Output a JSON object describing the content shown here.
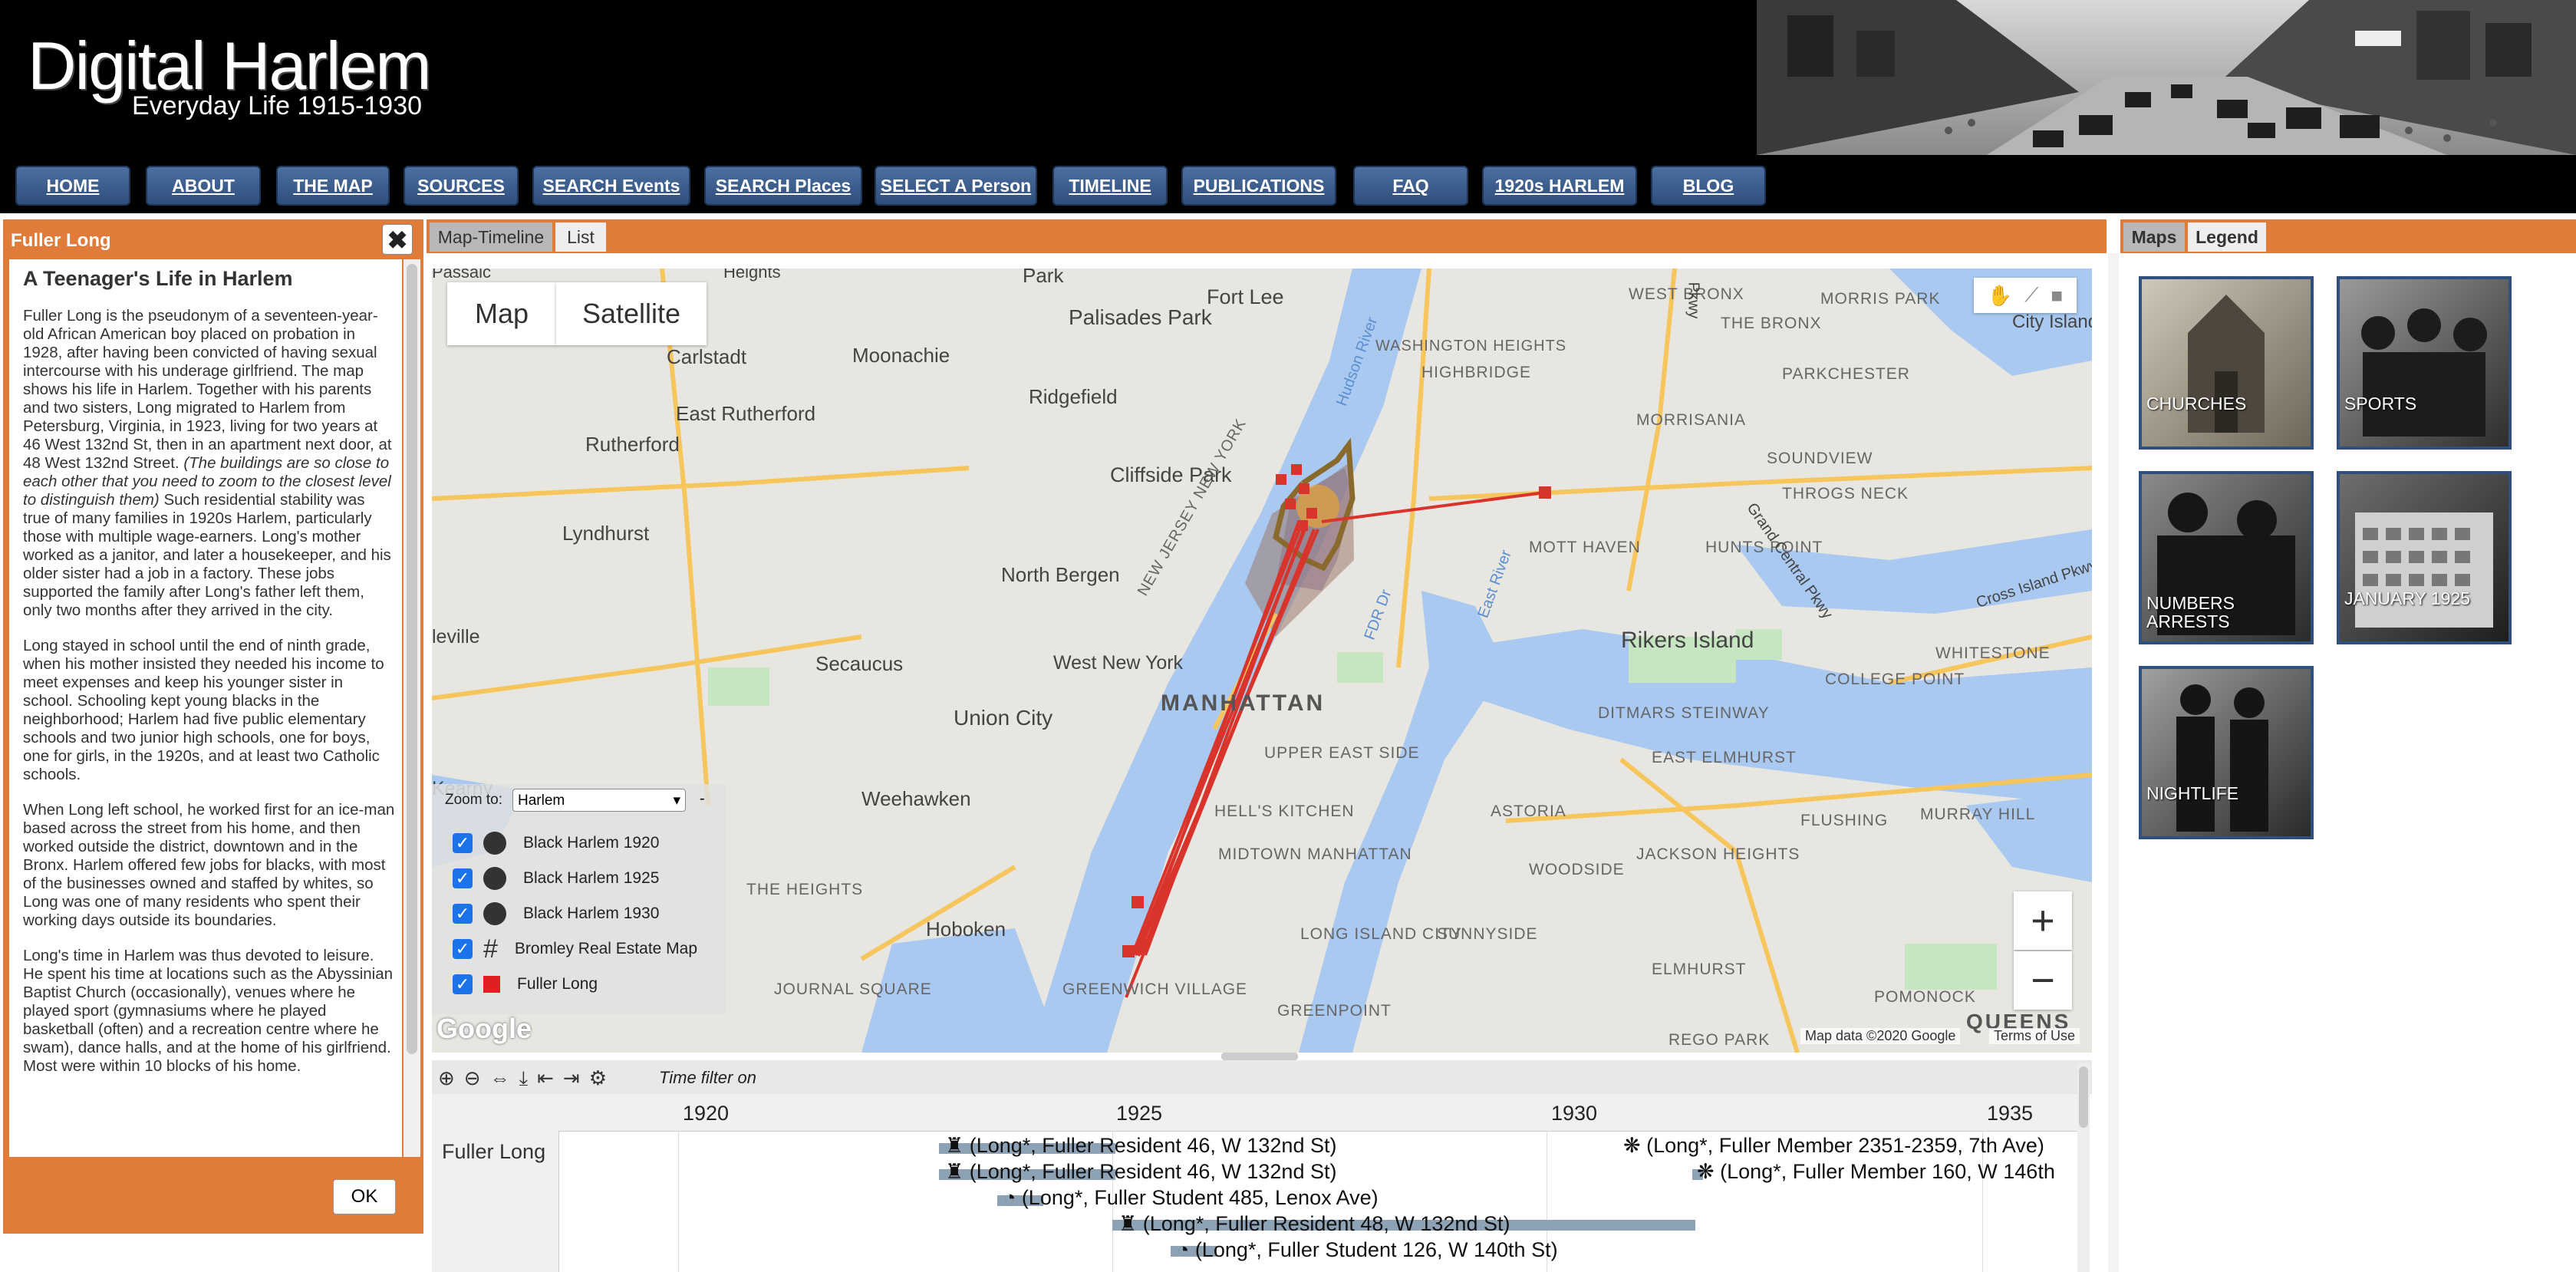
{
  "header": {
    "title": "Digital Harlem",
    "subtitle": "Everyday Life 1915-1930"
  },
  "nav": [
    "HOME",
    "ABOUT",
    "THE MAP",
    "SOURCES",
    "SEARCH Events",
    "SEARCH Places",
    "SELECT A Person",
    "TIMELINE",
    "PUBLICATIONS",
    "FAQ",
    "1920s HARLEM",
    "BLOG"
  ],
  "left": {
    "panel_title": "Fuller Long",
    "close": "✖",
    "heading": "A Teenager's Life in Harlem",
    "p1a": "Fuller Long is the pseudonym of a seventeen-year-old African American boy placed on probation in 1928, after having been convicted of having sexual intercourse with his underage girlfriend. The map shows his life in Harlem. Together with his parents and two sisters, Long migrated to Harlem from Petersburg, Virginia, in 1923, living for two years at 46 West 132nd St, then in an apartment next door, at 48 West 132nd Street.",
    "p1b": "(The buildings are so close to each other that you need to zoom to the closest level to distinguish them)",
    "p1c": "Such residential stability was true of many families in 1920s Harlem, particularly those with multiple wage-earners. Long's mother worked as a janitor, and later a housekeeper, and his older sister had a job in a factory. These jobs supported the family after Long's father left them, only two months after they arrived in the city.",
    "p2": "Long stayed in school until the end of ninth grade, when his mother insisted they needed his income to meet expenses and keep his younger sister in school. Schooling kept young blacks in the neighborhood; Harlem had five public elementary schools and two junior high schools, one for boys, one for girls, in the 1920s, and at least two Catholic schools.",
    "p3": "When Long left school, he worked first for an ice-man based across the street from his home, and then worked outside the district, downtown and in the Bronx. Harlem offered few jobs for blacks, with most of the businesses owned and staffed by whites, so Long was one of many residents who spent their working days outside its boundaries.",
    "p4": "Long's time in Harlem was thus devoted to leisure. He spent his time at locations such as the Abyssinian Baptist Church (occasionally), venues where he played sport (gymnasiums where he played basketball (often) and a recreation centre where he swam), dance halls, and at the home of his girlfriend. Most were within 10 blocks of his home.",
    "ok": "OK"
  },
  "center": {
    "tabs": [
      "Map-Timeline",
      "List"
    ],
    "map_type": [
      "Map",
      "Satellite"
    ],
    "zoom_label": "Zoom to:",
    "zoom_value": "Harlem",
    "zoom_dash": "-",
    "layers": [
      "Black Harlem 1920",
      "Black Harlem 1925",
      "Black Harlem 1930",
      "Bromley Real Estate Map",
      "Fuller Long"
    ],
    "map_labels": [
      "Park",
      "Fort Lee",
      "WEST BRONX",
      "MORRIS PARK",
      "City Island",
      "THE BRONX",
      "Palisades Park",
      "WASHINGTON HEIGHTS",
      "HIGHBRIDGE",
      "PARKCHESTER",
      "Carlstadt",
      "Moonachie",
      "Ridgefield",
      "East Rutherford",
      "MORRISANIA",
      "Rutherford",
      "SOUNDVIEW",
      "Cliffside Park",
      "THROGS NECK",
      "Lyndhurst",
      "MOTT HAVEN",
      "HUNTS POINT",
      "North Bergen",
      "Rikers Island",
      "leville",
      "Secaucus",
      "West New York",
      "WHITESTONE",
      "COLLEGE POINT",
      "Union City",
      "MANHATTAN",
      "DITMARS STEINWAY",
      "UPPER EAST SIDE",
      "EAST ELMHURST",
      "Kearny",
      "Weehawken",
      "HELL'S KITCHEN",
      "ASTORIA",
      "FLUSHING",
      "MURRAY HILL",
      "MIDTOWN MANHATTAN",
      "JACKSON HEIGHTS",
      "THE HEIGHTS",
      "WOODSIDE",
      "Hoboken",
      "LONG ISLAND CITY",
      "SUNNYSIDE",
      "ELMHURST",
      "JOURNAL SQUARE",
      "GREENWICH VILLAGE",
      "GREENPOINT",
      "POMONOCK",
      "REGO PARK",
      "QUEENS",
      "Hudson River",
      "East River",
      "NEW JERSEY NEW YORK",
      "Grand Central Pkwy",
      "Cross Island Pkwy",
      "FDR Dr",
      "Heights",
      "Passaic",
      "Pkwy"
    ],
    "google": "Google",
    "attribution": "Map data ©2020 Google",
    "terms": "Terms of Use",
    "zoom_in": "+",
    "zoom_out": "−",
    "timeline": {
      "filter": "Time filter on",
      "person": "Fuller Long",
      "years": [
        "1920",
        "1925",
        "1930",
        "1935"
      ],
      "events": [
        "(Long*, Fuller Resident 46, W 132nd St)",
        "(Long*, Fuller Resident 46, W 132nd St)",
        "(Long*, Fuller Student 485, Lenox Ave)",
        "(Long*, Fuller Resident 48, W 132nd St)",
        "(Long*, Fuller Student 126, W 140th St)",
        "(Long*, Fuller Member 2351-2359, 7th Ave)",
        "(Long*, Fuller Member 160, W 146th"
      ]
    }
  },
  "right": {
    "tabs": [
      "Maps",
      "Legend"
    ],
    "thumbs": [
      "CHURCHES",
      "SPORTS",
      "NUMBERS ARRESTS",
      "JANUARY 1925",
      "NIGHTLIFE"
    ]
  },
  "colors": {
    "orange": "#e07b39",
    "nav_blue": "#3b5d8f",
    "marker_red": "#d9342b"
  }
}
